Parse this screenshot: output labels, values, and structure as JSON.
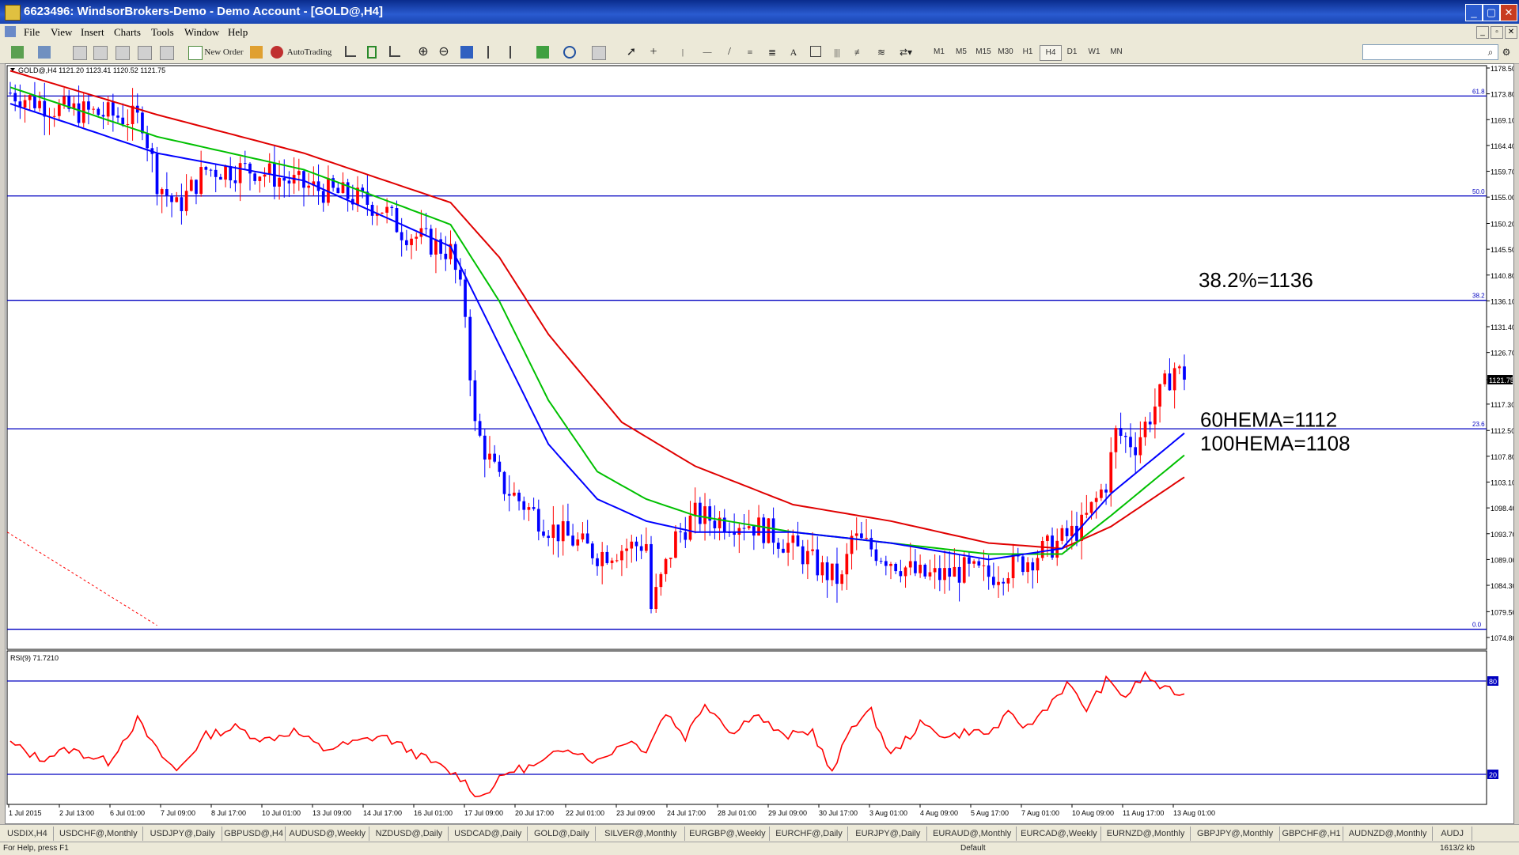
{
  "window": {
    "title": "6623496: WindsorBrokers-Demo - Demo Account - [GOLD@,H4]"
  },
  "menu": [
    "File",
    "View",
    "Insert",
    "Charts",
    "Tools",
    "Window",
    "Help"
  ],
  "toolbar": {
    "new_order": "New Order",
    "autotrading": "AutoTrading",
    "timeframes": [
      "M1",
      "M5",
      "M15",
      "M30",
      "H1",
      "H4",
      "D1",
      "W1",
      "MN"
    ],
    "text_tool": "A"
  },
  "chart": {
    "header": "GOLD@,H4  1121.20 1123.41 1120.52 1121.75",
    "current_price": "1121.75",
    "price_ticks": [
      "1178.50",
      "1173.80",
      "1169.10",
      "1164.40",
      "1159.70",
      "1155.00",
      "1150.20",
      "1145.50",
      "1140.80",
      "1136.10",
      "1131.40",
      "1126.70",
      "1121.75",
      "1117.30",
      "1112.50",
      "1107.80",
      "1103.10",
      "1098.40",
      "1093.70",
      "1089.00",
      "1084.30",
      "1079.50",
      "1074.80"
    ],
    "fib_levels": [
      "61.8",
      "50.0",
      "38.2",
      "23.6",
      "0.0"
    ],
    "annotations": [
      "38.2%=1136",
      "60HEMA=1112",
      "100HEMA=1108"
    ],
    "time_ticks": [
      "1 Jul 2015",
      "2 Jul 13:00",
      "6 Jul 01:00",
      "7 Jul 09:00",
      "8 Jul 17:00",
      "10 Jul 01:00",
      "13 Jul 09:00",
      "14 Jul 17:00",
      "16 Jul 01:00",
      "17 Jul 09:00",
      "20 Jul 17:00",
      "22 Jul 01:00",
      "23 Jul 09:00",
      "24 Jul 17:00",
      "28 Jul 01:00",
      "29 Jul 09:00",
      "30 Jul 17:00",
      "3 Aug 01:00",
      "4 Aug 09:00",
      "5 Aug 17:00",
      "7 Aug 01:00",
      "10 Aug 09:00",
      "11 Aug 17:00",
      "13 Aug 01:00"
    ],
    "colors": {
      "bull": "#ff0000",
      "bear": "#0000ff",
      "ema_fast": "#0000ff",
      "ema_mid": "#00c000",
      "ema_slow": "#e00000",
      "hline": "#0000c0"
    }
  },
  "rsi": {
    "header": "RSI(9) 71.7210",
    "levels": [
      "80",
      "20"
    ]
  },
  "tabs": [
    "USDIX,H4",
    "USDCHF@,Monthly",
    "USDJPY@,Daily",
    "GBPUSD@,H4",
    "AUDUSD@,Weekly",
    "NZDUSD@,Daily",
    "USDCAD@,Daily",
    "GOLD@,Daily",
    "SILVER@,Monthly",
    "EURGBP@,Weekly",
    "EURCHF@,Daily",
    "EURJPY@,Daily",
    "EURAUD@,Monthly",
    "EURCAD@,Weekly",
    "EURNZD@,Monthly",
    "GBPJPY@,Monthly",
    "GBPCHF@,H1",
    "AUDNZD@,Monthly",
    "AUDJ"
  ],
  "status": {
    "help": "For Help, press F1",
    "profile": "Default",
    "traffic": "1613/2 kb"
  },
  "chart_data": {
    "type": "candlestick",
    "title": "GOLD@,H4",
    "ylim": [
      1074.8,
      1178.5
    ],
    "current": 1121.75,
    "path_keypoints": [
      [
        0,
        1174
      ],
      [
        10,
        1171
      ],
      [
        20,
        1170
      ],
      [
        27,
        1169
      ],
      [
        30,
        1158
      ],
      [
        34,
        1153
      ],
      [
        40,
        1160
      ],
      [
        50,
        1160
      ],
      [
        60,
        1157
      ],
      [
        70,
        1155
      ],
      [
        76,
        1153
      ],
      [
        80,
        1149
      ],
      [
        85,
        1147
      ],
      [
        90,
        1145
      ],
      [
        93,
        1134
      ],
      [
        95,
        1113
      ],
      [
        100,
        1103
      ],
      [
        110,
        1095
      ],
      [
        120,
        1090
      ],
      [
        130,
        1092
      ],
      [
        131,
        1080
      ],
      [
        136,
        1093
      ],
      [
        140,
        1097
      ],
      [
        146,
        1096
      ],
      [
        150,
        1096
      ],
      [
        155,
        1094
      ],
      [
        162,
        1090
      ],
      [
        166,
        1087
      ],
      [
        170,
        1085
      ],
      [
        172,
        1093
      ],
      [
        178,
        1090
      ],
      [
        182,
        1088
      ],
      [
        186,
        1086
      ],
      [
        190,
        1086
      ],
      [
        195,
        1087
      ],
      [
        200,
        1086
      ],
      [
        208,
        1089
      ],
      [
        214,
        1092
      ],
      [
        219,
        1095
      ],
      [
        224,
        1103
      ],
      [
        226,
        1112
      ],
      [
        230,
        1110
      ],
      [
        234,
        1117
      ],
      [
        238,
        1124
      ],
      [
        240,
        1121.75
      ]
    ],
    "ema_fast_keypoints": [
      [
        0,
        1172
      ],
      [
        30,
        1163
      ],
      [
        60,
        1158
      ],
      [
        90,
        1146
      ],
      [
        100,
        1128
      ],
      [
        110,
        1110
      ],
      [
        120,
        1100
      ],
      [
        130,
        1096
      ],
      [
        140,
        1094
      ],
      [
        160,
        1094
      ],
      [
        180,
        1092
      ],
      [
        200,
        1089
      ],
      [
        215,
        1091
      ],
      [
        225,
        1101
      ],
      [
        240,
        1112
      ]
    ],
    "ema_mid_keypoints": [
      [
        0,
        1175
      ],
      [
        30,
        1166
      ],
      [
        60,
        1160
      ],
      [
        90,
        1150
      ],
      [
        100,
        1136
      ],
      [
        110,
        1118
      ],
      [
        120,
        1105
      ],
      [
        130,
        1100
      ],
      [
        140,
        1097
      ],
      [
        160,
        1094
      ],
      [
        180,
        1092
      ],
      [
        200,
        1090
      ],
      [
        215,
        1090
      ],
      [
        225,
        1097
      ],
      [
        240,
        1108
      ]
    ],
    "ema_slow_keypoints": [
      [
        0,
        1178
      ],
      [
        30,
        1170
      ],
      [
        60,
        1163
      ],
      [
        90,
        1154
      ],
      [
        100,
        1144
      ],
      [
        110,
        1130
      ],
      [
        125,
        1114
      ],
      [
        140,
        1106
      ],
      [
        160,
        1099
      ],
      [
        180,
        1096
      ],
      [
        200,
        1092
      ],
      [
        215,
        1091
      ],
      [
        225,
        1095
      ],
      [
        240,
        1104
      ]
    ],
    "fib_prices": [
      1173.4,
      1155.2,
      1136.2,
      1112.8,
      1076.3
    ],
    "annotation_prices": [
      1136,
      1112,
      1108
    ],
    "rsi_range": [
      0,
      100
    ],
    "rsi_levels": [
      80,
      20
    ],
    "rsi_keypoints": [
      [
        0,
        40
      ],
      [
        6,
        30
      ],
      [
        12,
        36
      ],
      [
        20,
        28
      ],
      [
        26,
        55
      ],
      [
        30,
        35
      ],
      [
        34,
        22
      ],
      [
        40,
        45
      ],
      [
        46,
        50
      ],
      [
        52,
        42
      ],
      [
        58,
        48
      ],
      [
        64,
        36
      ],
      [
        70,
        40
      ],
      [
        76,
        45
      ],
      [
        80,
        38
      ],
      [
        86,
        28
      ],
      [
        92,
        18
      ],
      [
        96,
        5
      ],
      [
        102,
        22
      ],
      [
        108,
        26
      ],
      [
        114,
        38
      ],
      [
        120,
        28
      ],
      [
        126,
        42
      ],
      [
        130,
        36
      ],
      [
        134,
        60
      ],
      [
        138,
        44
      ],
      [
        142,
        66
      ],
      [
        148,
        46
      ],
      [
        152,
        60
      ],
      [
        158,
        44
      ],
      [
        164,
        48
      ],
      [
        168,
        20
      ],
      [
        172,
        52
      ],
      [
        176,
        60
      ],
      [
        180,
        32
      ],
      [
        186,
        52
      ],
      [
        192,
        44
      ],
      [
        196,
        48
      ],
      [
        200,
        46
      ],
      [
        204,
        58
      ],
      [
        208,
        50
      ],
      [
        212,
        64
      ],
      [
        216,
        78
      ],
      [
        220,
        62
      ],
      [
        224,
        80
      ],
      [
        228,
        70
      ],
      [
        232,
        84
      ],
      [
        236,
        74
      ],
      [
        240,
        72
      ]
    ]
  }
}
